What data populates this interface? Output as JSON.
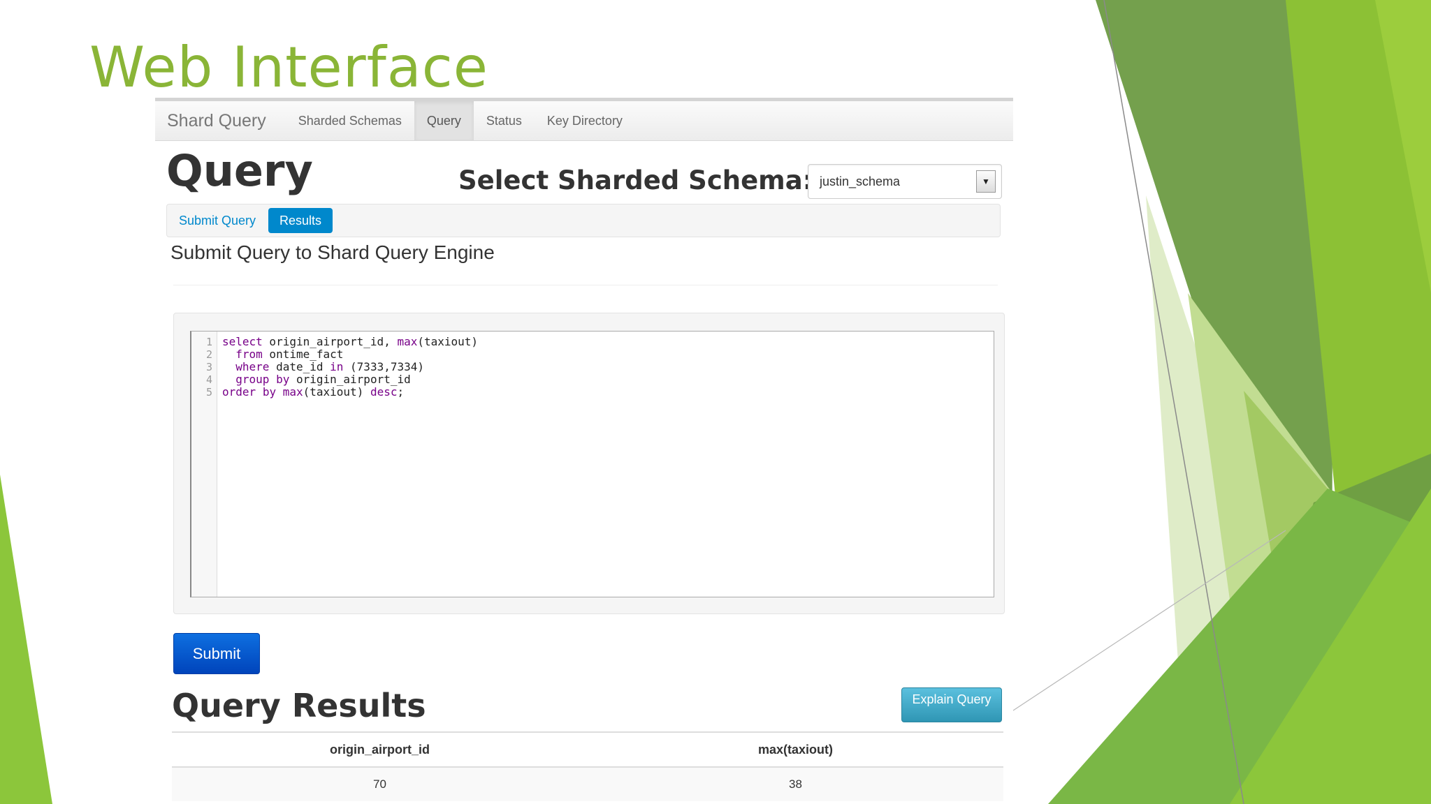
{
  "slide": {
    "title": "Web Interface"
  },
  "navbar": {
    "brand": "Shard Query",
    "items": [
      {
        "label": "Sharded Schemas"
      },
      {
        "label": "Query"
      },
      {
        "label": "Status"
      },
      {
        "label": "Key Directory"
      }
    ],
    "active_item": "Query"
  },
  "page": {
    "heading": "Query",
    "schema_label": "Select Sharded Schema:",
    "schema_value": "justin_schema",
    "subtabs": [
      {
        "label": "Submit Query"
      },
      {
        "label": "Results"
      }
    ],
    "active_subtab": "Results",
    "lead": "Submit Query to Shard Query Engine"
  },
  "editor": {
    "lines": [
      {
        "num": "1",
        "text": "select origin_airport_id, max(taxiout)"
      },
      {
        "num": "2",
        "text": "  from ontime_fact"
      },
      {
        "num": "3",
        "text": "  where date_id in (7333,7334)"
      },
      {
        "num": "4",
        "text": "  group by origin_airport_id"
      },
      {
        "num": "5",
        "text": "order by max(taxiout) desc;"
      }
    ]
  },
  "actions": {
    "submit_label": "Submit",
    "explain_label": "Explain Query"
  },
  "results": {
    "heading": "Query Results",
    "columns": [
      "origin_airport_id",
      "max(taxiout)"
    ],
    "rows": [
      [
        "70",
        "38"
      ]
    ]
  },
  "colors": {
    "title_green": "#8ab537",
    "primary_button": "#0055cc",
    "info_button": "#49afcd",
    "tab_active": "#0088cc"
  }
}
